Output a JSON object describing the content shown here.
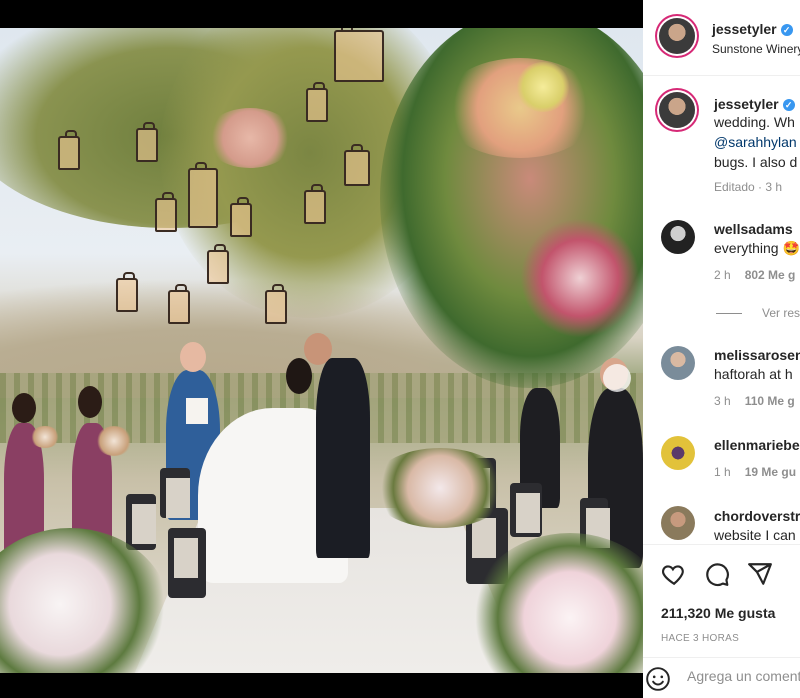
{
  "post": {
    "author": "jessetyler",
    "location": "Sunstone Winery",
    "caption_lines": [
      "wedding. Wh",
      "@sarahhylan",
      "bugs. I also d"
    ],
    "caption_time": "Editado · 3 h",
    "likes": "211,320 Me gusta",
    "posted": "HACE 3 HORAS",
    "comment_placeholder": "Agrega un comentario..."
  },
  "comments": [
    {
      "user": "wellsadams",
      "text": "everything 🤩",
      "time": "2 h",
      "likes": "802 Me g",
      "replies": "Ver res"
    },
    {
      "user": "melissarosen",
      "text": "haftorah at h",
      "time": "3 h",
      "likes": "110 Me g"
    },
    {
      "user": "ellenmariebe",
      "text": "",
      "time": "1 h",
      "likes": "19 Me gu"
    },
    {
      "user": "chordoverstr",
      "text": "website I can",
      "time": "",
      "likes": ""
    }
  ],
  "icons": {
    "like": "heart-icon",
    "comment": "comment-icon",
    "share": "share-icon",
    "emoji": "emoji-icon",
    "verified": "verified-badge-icon"
  },
  "colors": {
    "verified": "#3897f0",
    "link": "#00376b",
    "muted": "#8e8e8e",
    "text": "#262626"
  }
}
